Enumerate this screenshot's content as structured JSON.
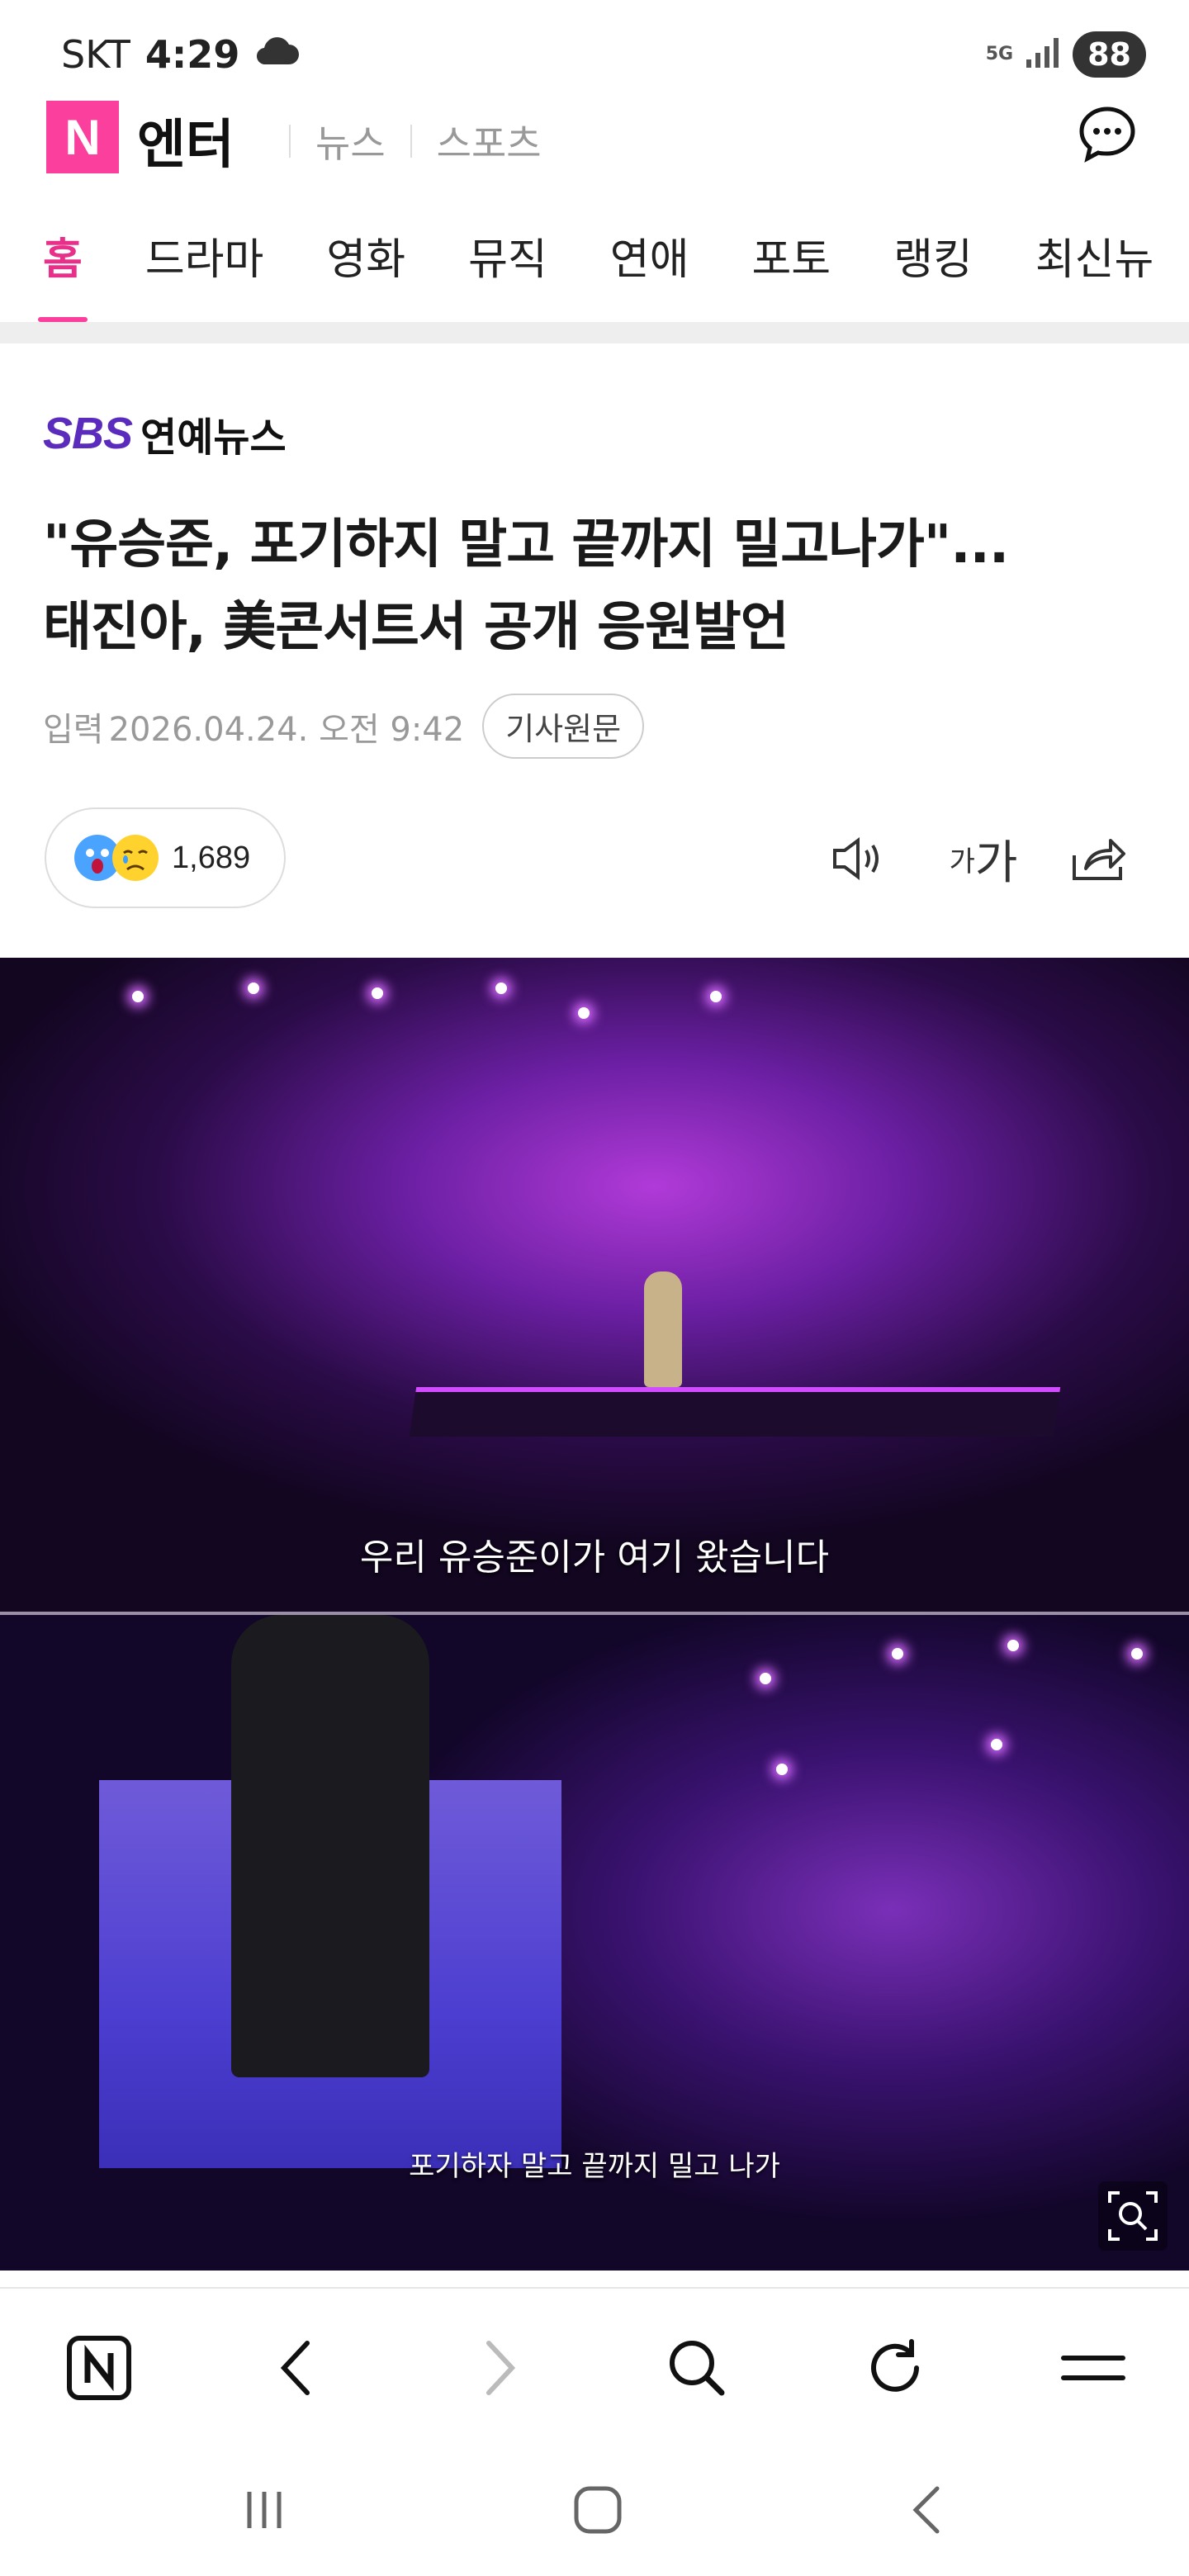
{
  "status_bar": {
    "carrier": "SKT",
    "time": "4:29",
    "network": "5G",
    "battery": "88"
  },
  "app_header": {
    "logo_letter": "N",
    "brand": "엔터",
    "links": [
      "뉴스",
      "스포츠"
    ]
  },
  "tabs": [
    "홈",
    "드라마",
    "영화",
    "뮤직",
    "연애",
    "포토",
    "랭킹",
    "최신뉴"
  ],
  "active_tab": "홈",
  "article": {
    "source_logo": "SBS",
    "source_sub": "연예뉴스",
    "title_line1": "\"유승준, 포기하지 말고 끝까지 밀고나가\"...",
    "title_line2": "태진아, 美콘서트서 공개 응원발언",
    "input_label": "입력",
    "date": "2026.04.24. 오전 9:42",
    "original_button": "기사원문",
    "reaction_count": "1,689",
    "font_small": "가",
    "font_large": "가"
  },
  "media": {
    "subtitle_top": "우리 유승준이가 여기 왔습니다",
    "subtitle_bottom": "포기하자 말고 끝까지 밀고 나가"
  },
  "colors": {
    "brand_pink": "#fa3f9d",
    "sbs_purple": "#5a2bbd"
  },
  "icons": {
    "chat": "chat-bubble-icon",
    "sound": "speaker-icon",
    "share": "share-icon",
    "zoom": "zoom-icon",
    "home": "n-home-icon",
    "back": "chevron-left-icon",
    "forward": "chevron-right-icon",
    "search": "search-icon",
    "refresh": "refresh-icon",
    "menu": "hamburger-icon"
  }
}
